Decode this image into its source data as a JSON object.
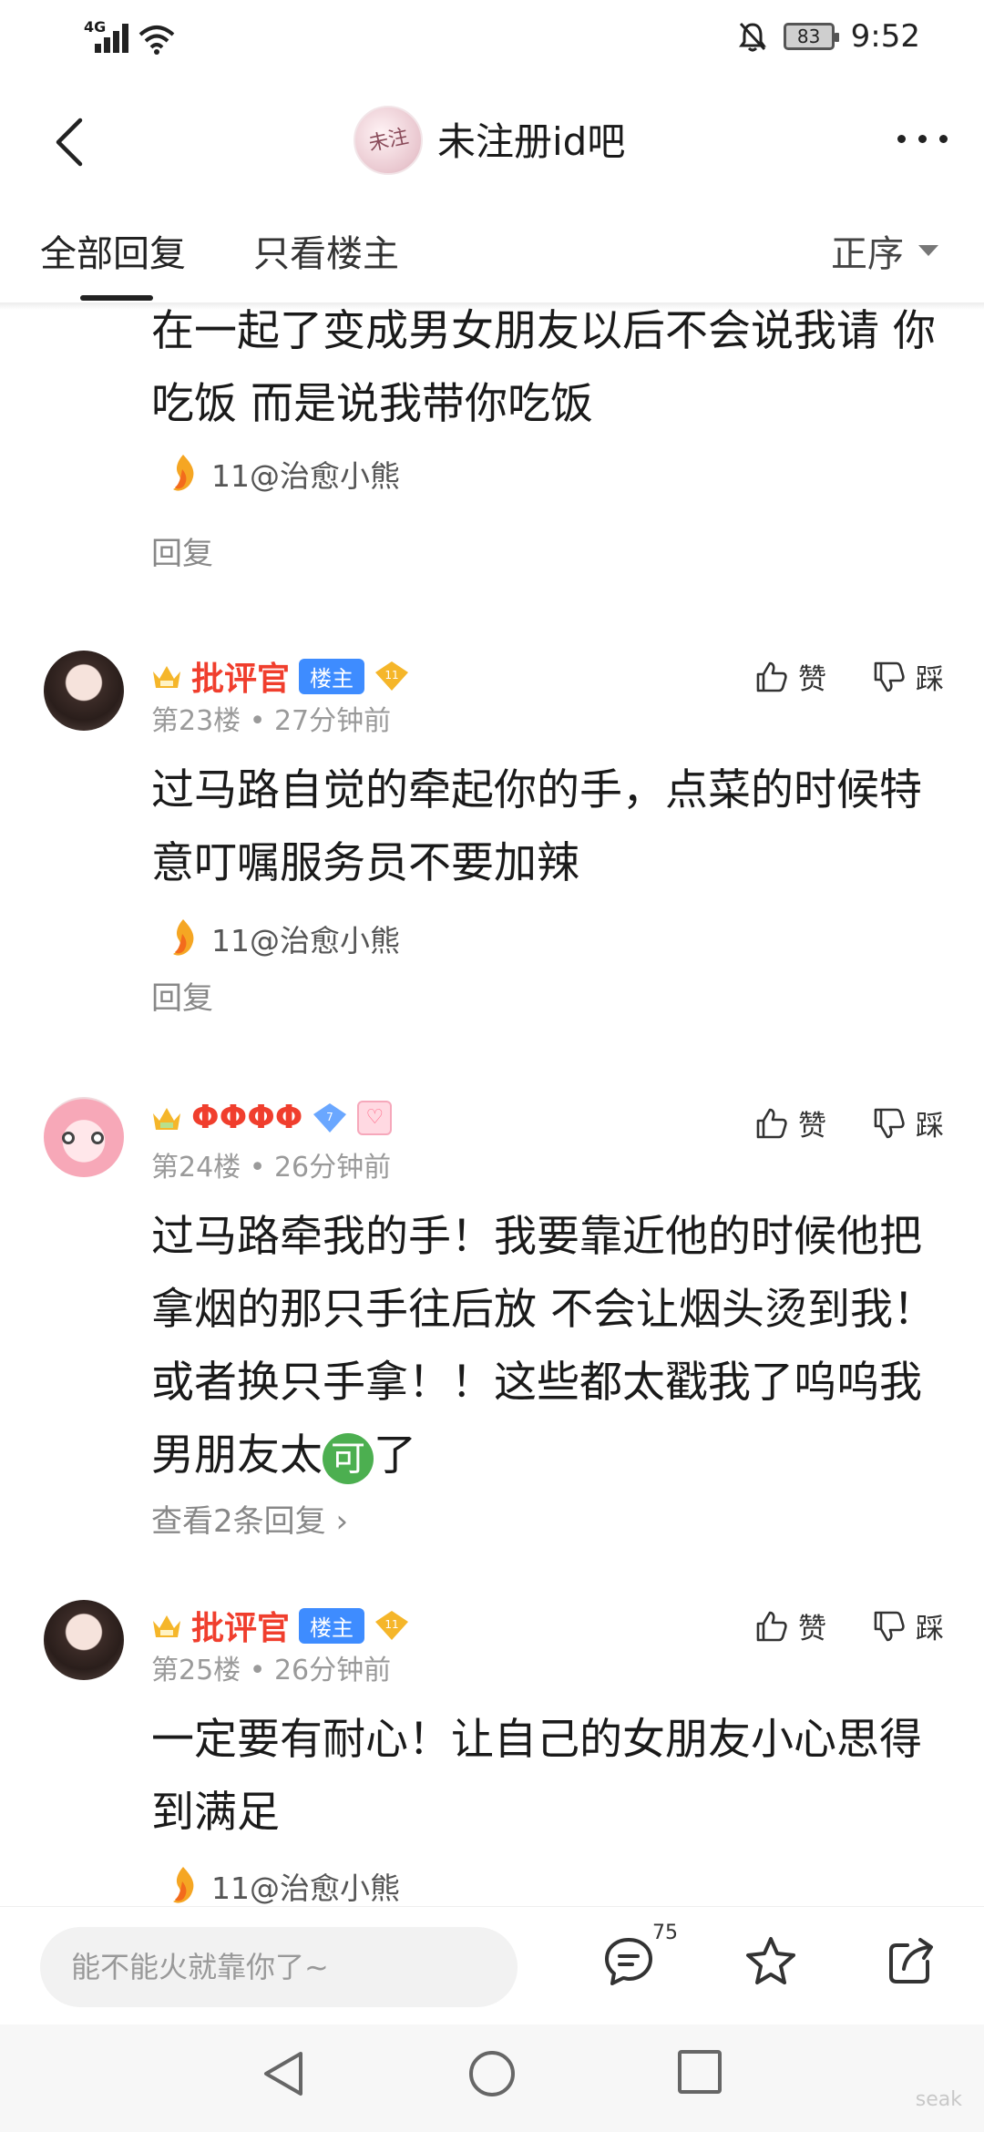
{
  "status_bar": {
    "network": "4G",
    "battery": "83",
    "time": "9:52"
  },
  "header": {
    "forum_name": "未注册id吧"
  },
  "tabs": {
    "all": "全部回复",
    "op_only": "只看楼主",
    "sort": "正序"
  },
  "top_post": {
    "text": "在一起了变成男女朋友以后不会说我请 你吃饭 而是说我带你吃饭",
    "sub_reply_user": "11@治愈小熊",
    "reply_label": "回复"
  },
  "floors": [
    {
      "username": "批评官",
      "op_badge": "楼主",
      "level": "11",
      "floor": "第23楼",
      "time": "27分钟前",
      "like_label": "赞",
      "dislike_label": "踩",
      "text": "过马路自觉的牵起你的手，点菜的时候特意叮嘱服务员不要加辣",
      "sub_reply_user": "11@治愈小熊",
      "reply_label": "回复"
    },
    {
      "username": "ΦΦΦΦ",
      "level": "7",
      "floor": "第24楼",
      "time": "26分钟前",
      "like_label": "赞",
      "dislike_label": "踩",
      "text_before": "过马路牵我的手！我要靠近他的时候他把拿烟的那只手往后放 不会让烟头烫到我！或者换只手拿！！这些都太戳我了呜呜我男朋友太",
      "emoji_text": "可",
      "text_after": "了",
      "view_more": "查看2条回复"
    },
    {
      "username": "批评官",
      "op_badge": "楼主",
      "level": "11",
      "floor": "第25楼",
      "time": "26分钟前",
      "like_label": "赞",
      "dislike_label": "踩",
      "text": "一定要有耐心！让自己的女朋友小心思得到满足",
      "sub_reply_user": "11@治愈小熊"
    }
  ],
  "bottom_bar": {
    "placeholder": "能不能火就靠你了~",
    "comment_count": "75"
  },
  "watermark": "seak",
  "colors": {
    "username_red": "#f03e2d",
    "op_badge_blue": "#3e8cff",
    "level_gold": "#f5b62a"
  }
}
